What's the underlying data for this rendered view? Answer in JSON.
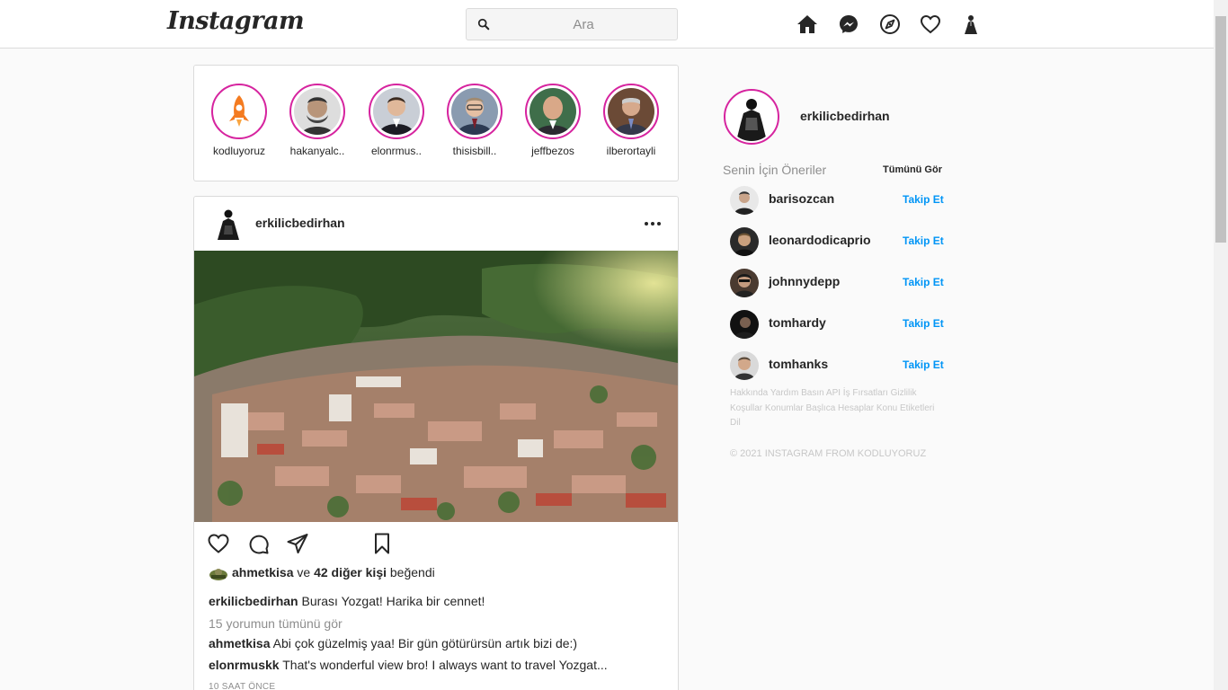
{
  "header": {
    "logo": "Instagram",
    "search_placeholder": "Ara",
    "icons": [
      "home-icon",
      "messenger-icon",
      "explore-icon",
      "heart-icon",
      "profile-icon"
    ]
  },
  "stories": [
    {
      "name": "kodluyoruz"
    },
    {
      "name": "hakanyalc.."
    },
    {
      "name": "elonrmus.."
    },
    {
      "name": "thisisbill.."
    },
    {
      "name": "jeffbezos"
    },
    {
      "name": "ilberortayli"
    }
  ],
  "post": {
    "username": "erkilicbedirhan",
    "likes": {
      "first_user": "ahmetkisa",
      "connector": "ve",
      "others": "42 diğer kişi",
      "suffix": "beğendi"
    },
    "caption": {
      "user": "erkilicbedirhan",
      "text": "Burası Yozgat! Harika bir cennet!"
    },
    "view_all_comments": "15 yorumun tümünü gör",
    "comments": [
      {
        "user": "ahmetkisa",
        "text": "Abi çok güzelmiş yaa! Bir gün götürürsün artık bizi de:)"
      },
      {
        "user": "elonrmuskk",
        "text": "That's wonderful view bro! I always want to travel Yozgat..."
      }
    ],
    "time": "10 SAAT ÖNCE"
  },
  "sidebar": {
    "username": "erkilicbedirhan",
    "suggestions_title": "Senin İçin Öneriler",
    "see_all": "Tümünü Gör",
    "suggestions": [
      {
        "user": "barisozcan",
        "action": "Takip Et"
      },
      {
        "user": "leonardodicaprio",
        "action": "Takip Et"
      },
      {
        "user": "johnnydepp",
        "action": "Takip Et"
      },
      {
        "user": "tomhardy",
        "action": "Takip Et"
      },
      {
        "user": "tomhanks",
        "action": "Takip Et"
      }
    ],
    "footer_links": "Hakkında Yardım Basın API İş Fırsatları Gizlilik Koşullar Konumlar Başlıca Hesaplar Konu Etiketleri Dil",
    "copyright": "© 2021 INSTAGRAM FROM KODLUYORUZ"
  },
  "colors": {
    "accent": "#0095f6",
    "story_ring": "#d6249f",
    "border": "#dbdbdb"
  }
}
